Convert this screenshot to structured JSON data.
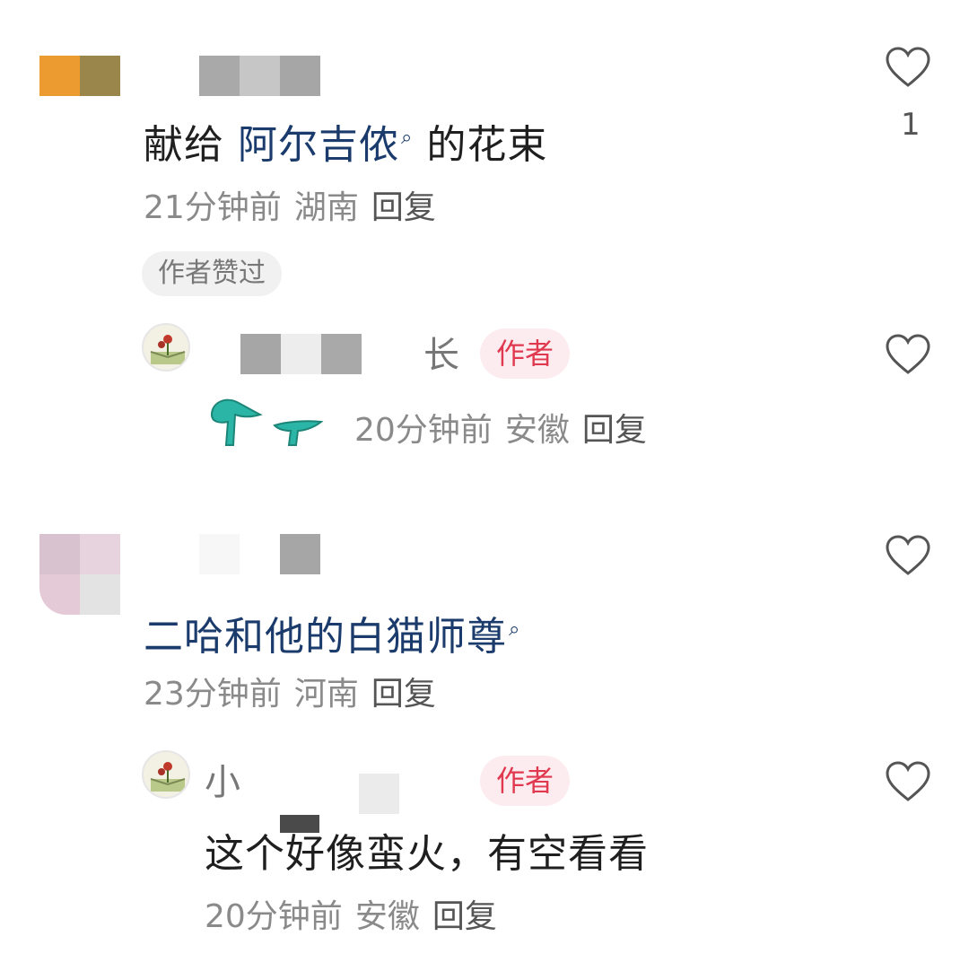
{
  "comments": [
    {
      "text_prefix": "献给 ",
      "topic": "阿尔吉侬",
      "text_suffix": " 的花束",
      "time": "21分钟前",
      "location": "湖南",
      "reply_label": "回复",
      "badge": "作者赞过",
      "like_count": "1",
      "icons": {
        "like": "heart-outline-icon",
        "topic_search": "search-icon"
      }
    },
    {
      "author_name_suffix": "长",
      "author_badge": "作者",
      "time": "20分钟前",
      "location": "安徽",
      "reply_label": "回复",
      "sticker": "green-sprout-sticker"
    },
    {
      "topic": "二哈和他的白猫师尊",
      "time": "23分钟前",
      "location": "河南",
      "reply_label": "回复"
    },
    {
      "author_name_prefix": "小",
      "author_badge": "作者",
      "text": "这个好像蛮火，有空看看",
      "time": "20分钟前",
      "location": "安徽",
      "reply_label": "回复"
    }
  ],
  "colors": {
    "topic": "#1a3b6b",
    "author_badge_bg": "#fdecef",
    "author_badge_text": "#e0384f",
    "meta": "#8a8a8a"
  }
}
